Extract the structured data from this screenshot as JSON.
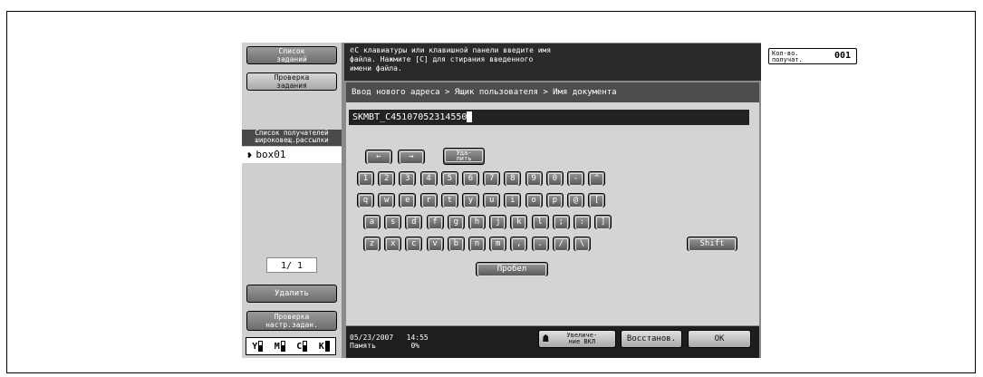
{
  "left": {
    "jobs_list_label": "Список\nзаданий",
    "job_check_label": "Проверка\nзадания",
    "recipients_header": "Список получателей\nшироковещ.рассылки",
    "recipient_item": "box01",
    "pager": "1/  1",
    "delete_label": "Удалить",
    "check_settings_label": "Проверка\nнастр.задан.",
    "toner": [
      "Y",
      "M",
      "C",
      "K"
    ]
  },
  "message": {
    "text": "С клавиатуры или клавишной панели введите имя\nфайла. Нажмите [C] для стирания введенного\nимени файла.",
    "count_label": "Кол-во.\nполучат.",
    "count_value": "001"
  },
  "breadcrumb": "Ввод нового адреса > Ящик пользователя > Имя документа",
  "input": {
    "value": "SKMBT_C45107052314550"
  },
  "keyboard": {
    "left_arrow": "←",
    "right_arrow": "→",
    "delete": "Уда-\nлить",
    "row1": [
      "1",
      "2",
      "3",
      "4",
      "5",
      "6",
      "7",
      "8",
      "9",
      "0",
      "-",
      "^"
    ],
    "row2": [
      "q",
      "w",
      "e",
      "r",
      "t",
      "y",
      "u",
      "i",
      "o",
      "p",
      "@",
      "["
    ],
    "row3": [
      "a",
      "s",
      "d",
      "f",
      "g",
      "h",
      "j",
      "k",
      "l",
      ";",
      ":",
      "]"
    ],
    "row4": [
      "z",
      "x",
      "c",
      "v",
      "b",
      "n",
      "m",
      ",",
      ".",
      "/",
      "\\"
    ],
    "shift": "Shift",
    "space": "Пробел"
  },
  "status": {
    "date": "05/23/2007",
    "time": "14:55",
    "memory_label": "Память",
    "memory_value": "0%",
    "zoom_label": "Увеличе-\nние ВКЛ",
    "restore_label": "Восстанов.",
    "ok_label": "OK"
  }
}
